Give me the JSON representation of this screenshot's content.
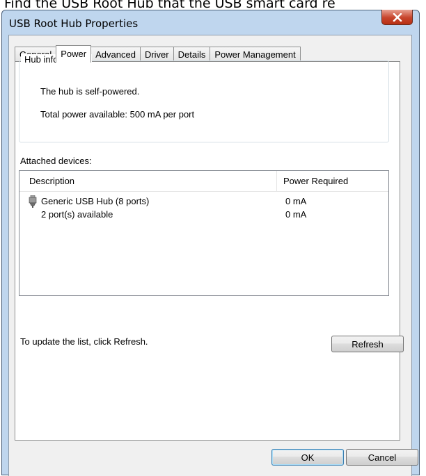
{
  "background_caption": "Find the USB Root Hub that the USB smart card re",
  "dialog": {
    "title": "USB Root Hub Properties",
    "close_glyph": "x"
  },
  "tabs": [
    {
      "label": "General",
      "active": false
    },
    {
      "label": "Power",
      "active": true
    },
    {
      "label": "Advanced",
      "active": false
    },
    {
      "label": "Driver",
      "active": false
    },
    {
      "label": "Details",
      "active": false
    },
    {
      "label": "Power Management",
      "active": false
    }
  ],
  "hub_info": {
    "group_title": "Hub information",
    "self_powered_text": "The hub is self-powered.",
    "total_power_text": "Total power available:  500 mA per port"
  },
  "attached": {
    "label": "Attached devices:",
    "columns": [
      "Description",
      "Power Required"
    ],
    "rows": [
      {
        "description": "Generic USB Hub (8 ports)",
        "power": "0 mA",
        "icon": "usb-plug-icon"
      },
      {
        "description": "2 port(s) available",
        "power": "0 mA",
        "icon": ""
      }
    ]
  },
  "update_hint": "To update the list, click Refresh.",
  "buttons": {
    "refresh": "Refresh",
    "ok": "OK",
    "cancel": "Cancel"
  },
  "colors": {
    "frame": "#bfd6ee",
    "close_button": "#c7442b",
    "dialog_body": "#f0f0f0"
  }
}
